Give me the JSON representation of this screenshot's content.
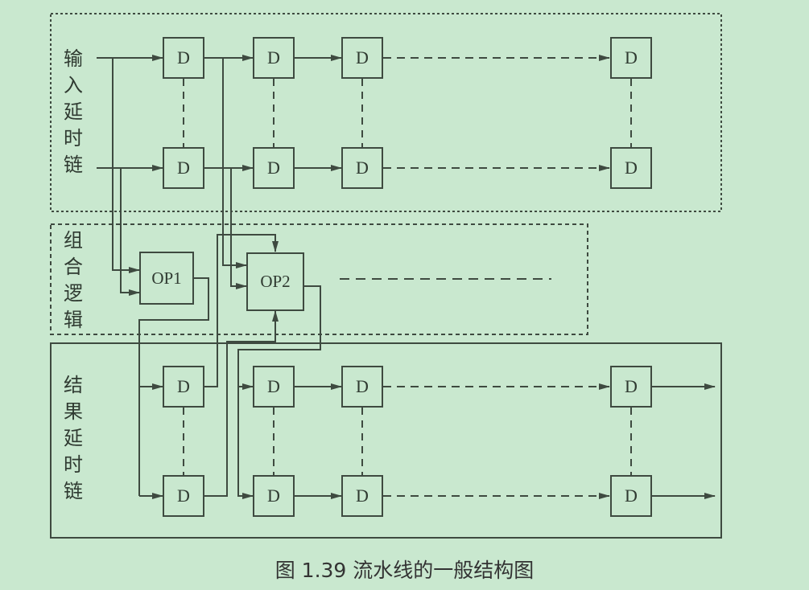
{
  "input_chain": {
    "label_chars": [
      "输",
      "入",
      "延",
      "时",
      "链"
    ]
  },
  "logic": {
    "label_chars": [
      "组",
      "合",
      "逻",
      "辑"
    ]
  },
  "result_chain": {
    "label_chars": [
      "结",
      "果",
      "延",
      "时",
      "链"
    ]
  },
  "register_label": "D",
  "op1_label": "OP1",
  "op2_label": "OP2",
  "caption": "图 1.39   流水线的一般结构图",
  "colors": {
    "background": "#c9e8cf",
    "line": "#3e4a40",
    "text": "#2f3a31"
  }
}
